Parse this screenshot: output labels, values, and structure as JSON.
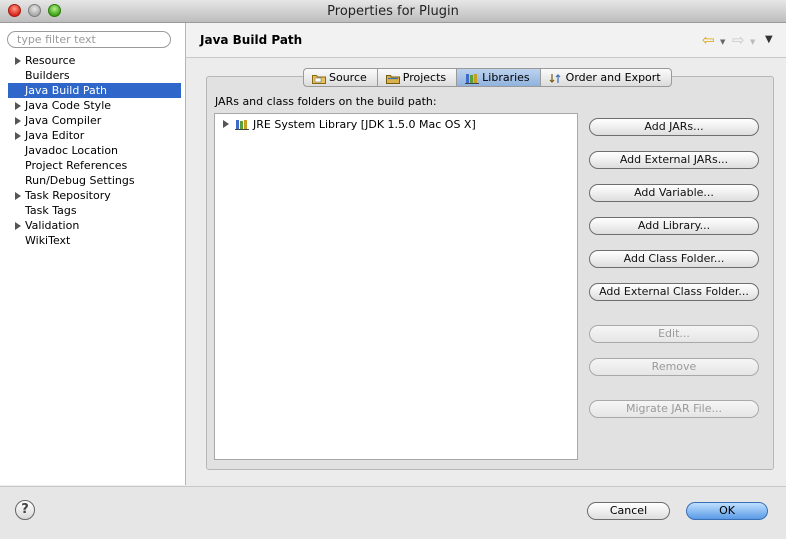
{
  "window": {
    "title": "Properties for Plugin"
  },
  "filter": {
    "placeholder": "type filter text"
  },
  "tree": [
    {
      "label": "Resource",
      "expandable": true
    },
    {
      "label": "Builders",
      "expandable": false
    },
    {
      "label": "Java Build Path",
      "expandable": false,
      "selected": true
    },
    {
      "label": "Java Code Style",
      "expandable": true
    },
    {
      "label": "Java Compiler",
      "expandable": true
    },
    {
      "label": "Java Editor",
      "expandable": true
    },
    {
      "label": "Javadoc Location",
      "expandable": false
    },
    {
      "label": "Project References",
      "expandable": false
    },
    {
      "label": "Run/Debug Settings",
      "expandable": false
    },
    {
      "label": "Task Repository",
      "expandable": true
    },
    {
      "label": "Task Tags",
      "expandable": false
    },
    {
      "label": "Validation",
      "expandable": true
    },
    {
      "label": "WikiText",
      "expandable": false
    }
  ],
  "header": {
    "title": "Java Build Path"
  },
  "tabs": [
    {
      "label": "Source",
      "icon": "source-folder-icon"
    },
    {
      "label": "Projects",
      "icon": "projects-icon"
    },
    {
      "label": "Libraries",
      "icon": "libraries-icon",
      "active": true
    },
    {
      "label": "Order and Export",
      "icon": "order-export-icon"
    }
  ],
  "build_path": {
    "label": "JARs and class folders on the build path:",
    "entries": [
      {
        "label": "JRE System Library [JDK 1.5.0 Mac OS X]"
      }
    ]
  },
  "buttons": {
    "add_jars": "Add JARs...",
    "add_external_jars": "Add External JARs...",
    "add_variable": "Add Variable...",
    "add_library": "Add Library...",
    "add_class_folder": "Add Class Folder...",
    "add_external_class_folder": "Add External Class Folder...",
    "edit": "Edit...",
    "remove": "Remove",
    "migrate_jar": "Migrate JAR File..."
  },
  "dialog": {
    "help": "?",
    "cancel": "Cancel",
    "ok": "OK"
  },
  "colors": {
    "selection": "#2e66c9",
    "ok_button": "#5a9be6"
  }
}
